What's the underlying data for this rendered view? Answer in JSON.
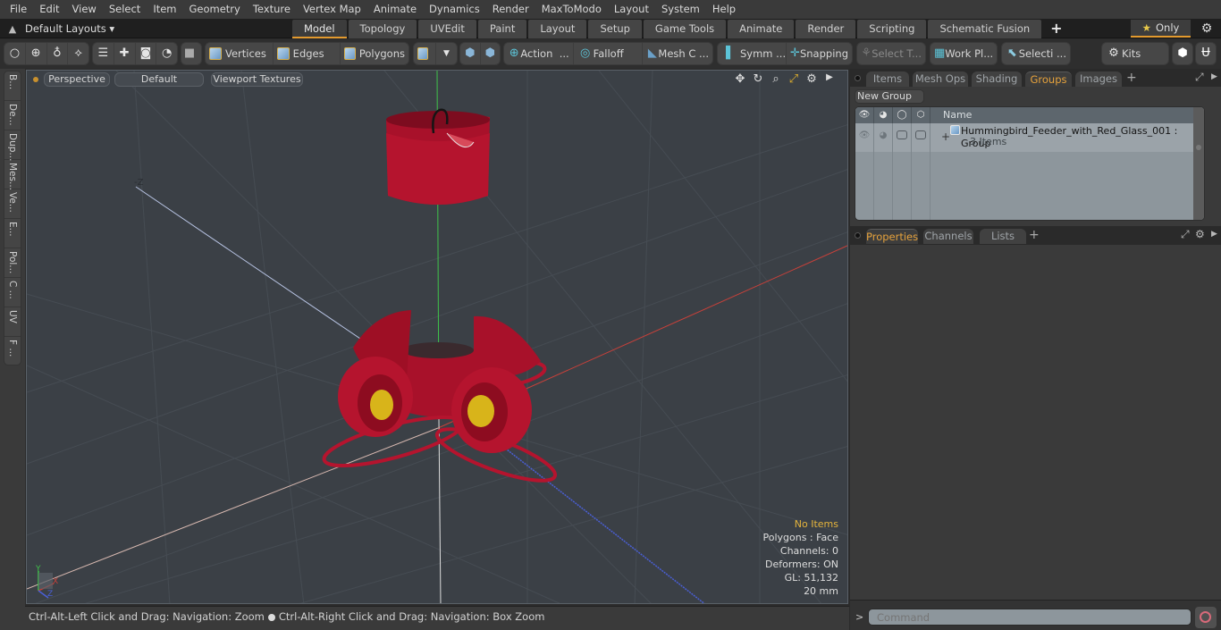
{
  "menu": [
    "File",
    "Edit",
    "View",
    "Select",
    "Item",
    "Geometry",
    "Texture",
    "Vertex Map",
    "Animate",
    "Dynamics",
    "Render",
    "MaxToModo",
    "Layout",
    "System",
    "Help"
  ],
  "layout_bar": {
    "layouts_label": "Default Layouts ▾",
    "tabs": [
      "Model",
      "Topology",
      "UVEdit",
      "Paint",
      "Layout",
      "Setup",
      "Game Tools",
      "Animate",
      "Render",
      "Scripting",
      "Schematic Fusion"
    ],
    "active_tab": "Model",
    "add_tab": "+",
    "only_label": "Only"
  },
  "toolbar": {
    "vertices": "Vertices",
    "edges": "Edges",
    "polygons": "Polygons",
    "action": "Action",
    "action_more": "...",
    "falloff": "Falloff",
    "mesh_c": "Mesh C ...",
    "symm": "Symm ...",
    "snapping": "Snapping",
    "select_t": "Select T...",
    "work_pl": "Work Pl...",
    "selecti": "Selecti ...",
    "kits": "Kits"
  },
  "left_tabs": [
    "B...",
    "De...",
    "Dup...",
    "Mes...",
    "Ve...",
    "E...",
    "Pol...",
    "C ...",
    "UV",
    "F ..."
  ],
  "viewport": {
    "view_mode": "Perspective",
    "shading": "Default",
    "textures": "Viewport Textures",
    "axis_label_neg_z": "-Z",
    "gizmo": {
      "y": "Y",
      "x": "X",
      "z": "Z"
    },
    "hud": {
      "selection": "No Items",
      "polygons": "Polygons : Face",
      "channels": "Channels: 0",
      "deformers": "Deformers: ON",
      "gl": "GL: 51,132",
      "scale": "20 mm"
    },
    "colors": {
      "background": "#3b4046",
      "x_axis": "#c8403a",
      "y_axis": "#3fc24a",
      "z_axis": "#4a5fd6",
      "model_red": "#b0122a",
      "model_yellow": "#d8b41a"
    }
  },
  "status_bar": {
    "hint_left": "Ctrl-Alt-Left Click and Drag: Navigation: Zoom",
    "hint_right": "Ctrl-Alt-Right Click and Drag: Navigation: Box Zoom"
  },
  "right_panel": {
    "top_tabs": [
      "Items",
      "Mesh Ops",
      "Shading",
      "Groups",
      "Images"
    ],
    "top_active": "Groups",
    "new_group": "New Group",
    "columns": {
      "name": "Name"
    },
    "groups": [
      {
        "name": "Hummingbird_Feeder_with_Red_Glass_001 : Group",
        "count": "3 Items"
      }
    ],
    "bottom_tabs": [
      "Properties",
      "Channels",
      "Lists"
    ],
    "bottom_active": "Properties",
    "command_prompt": ">",
    "command_placeholder": "Command"
  },
  "accent_color": "#e39a2e"
}
